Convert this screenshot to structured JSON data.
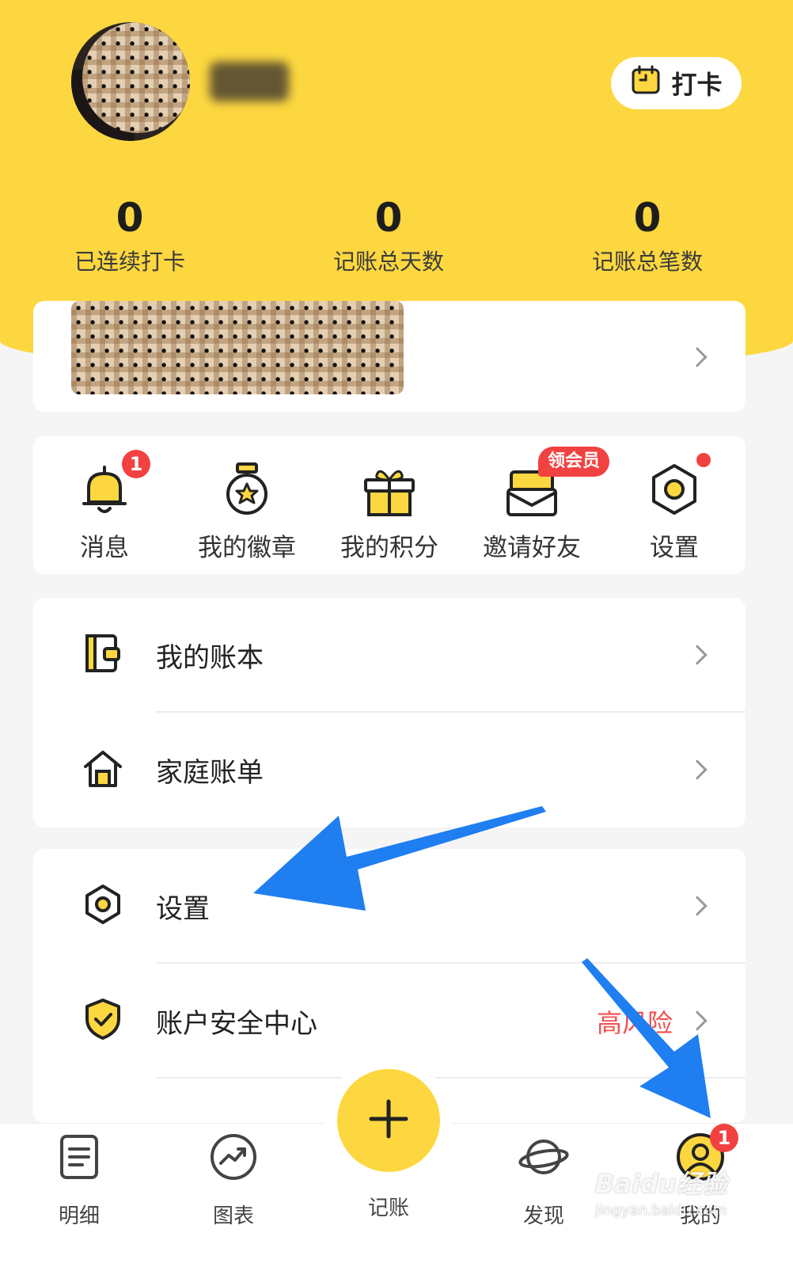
{
  "header": {
    "checkin_label": "打卡"
  },
  "stats": [
    {
      "value": "0",
      "label": "已连续打卡"
    },
    {
      "value": "0",
      "label": "记账总天数"
    },
    {
      "value": "0",
      "label": "记账总笔数"
    }
  ],
  "quick_actions": [
    {
      "label": "消息",
      "icon": "bell-icon",
      "badge": "1"
    },
    {
      "label": "我的徽章",
      "icon": "medal-icon"
    },
    {
      "label": "我的积分",
      "icon": "gift-icon"
    },
    {
      "label": "邀请好友",
      "icon": "envelope-icon",
      "badge": "领会员"
    },
    {
      "label": "设置",
      "icon": "gear-hex-icon"
    }
  ],
  "list_group_1": [
    {
      "label": "我的账本",
      "icon": "ledger-icon"
    },
    {
      "label": "家庭账单",
      "icon": "home-icon"
    }
  ],
  "list_group_2": [
    {
      "label": "设置",
      "icon": "gear-hex-icon"
    },
    {
      "label": "账户安全中心",
      "icon": "shield-check-icon",
      "extra": "高风险"
    }
  ],
  "tabbar": {
    "tabs": [
      {
        "label": "明细",
        "icon": "list-doc-icon"
      },
      {
        "label": "图表",
        "icon": "trend-chart-icon"
      },
      {
        "label": "记账",
        "icon": "plus-icon"
      },
      {
        "label": "发现",
        "icon": "planet-icon"
      },
      {
        "label": "我的",
        "icon": "user-icon",
        "badge": "1"
      }
    ]
  },
  "watermark": {
    "brand": "Baidu经验",
    "url": "jingyan.baidu.com"
  },
  "colors": {
    "accent": "#fdd73f",
    "badge": "#f24141",
    "annotation_arrow": "#1f7ef0"
  }
}
